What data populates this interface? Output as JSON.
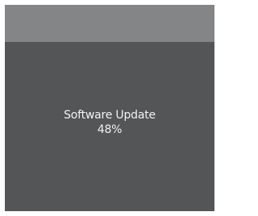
{
  "screen": {
    "title": "Software Update",
    "progress_text": "48%",
    "progress": 0.48
  },
  "colors": {
    "background": "#545556",
    "top_bar": "#848587",
    "text": "#f2f2f2",
    "page_margin": "#ffffff"
  }
}
